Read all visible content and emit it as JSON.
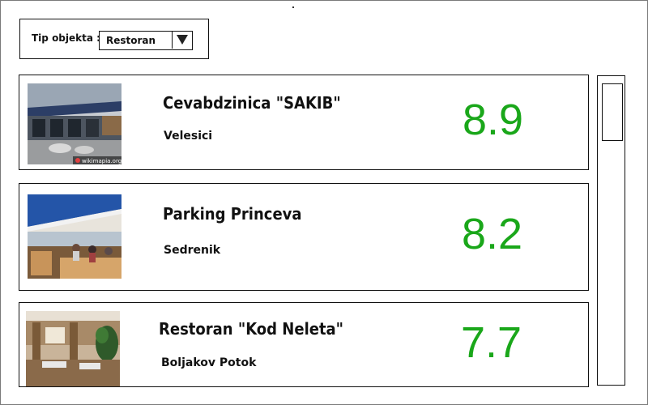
{
  "filter": {
    "label": "Tip objekta :",
    "selected": "Restoran"
  },
  "results": [
    {
      "name": "Cevabdzinica \"SAKIB\"",
      "location": "Velesici",
      "rating": "8.9",
      "photo_credit": "wikimapia.org"
    },
    {
      "name": "Parking Princeva",
      "location": "Sedrenik",
      "rating": "8.2"
    },
    {
      "name": "Restoran \"Kod Neleta\"",
      "location": "Boljakov Potok",
      "rating": "7.7"
    }
  ],
  "colors": {
    "rating": "#1aa71a",
    "border": "#111111"
  }
}
